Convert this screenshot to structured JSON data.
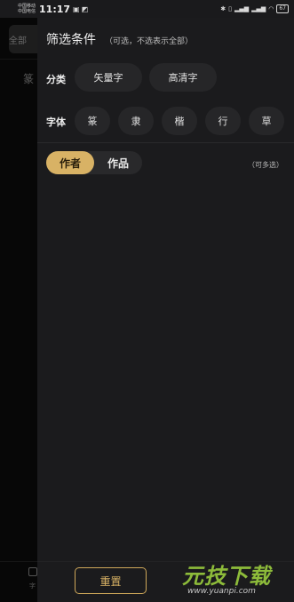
{
  "status_bar": {
    "carrier1": "中国移动",
    "carrier2": "中国电信",
    "time": "11:17",
    "battery": "67"
  },
  "background": {
    "search_text": "全部",
    "tab_label": "篆",
    "bottom_label": "字"
  },
  "panel": {
    "title": "筛选条件",
    "subtitle": "（可选，不选表示全部）",
    "category": {
      "label": "分类",
      "options": [
        "矢量字",
        "高清字"
      ]
    },
    "font": {
      "label": "字体",
      "options": [
        "篆",
        "隶",
        "楷",
        "行",
        "草"
      ]
    },
    "tabs": {
      "author": "作者",
      "work": "作品",
      "active": "作者"
    },
    "multi_hint": "（可多选）",
    "reset_label": "重置"
  },
  "watermark": {
    "main": "元技下载",
    "url": "www.yuanpi.com"
  },
  "colors": {
    "accent": "#d8b265",
    "panel_bg": "#1b1b1d",
    "chip_bg": "#262628"
  }
}
